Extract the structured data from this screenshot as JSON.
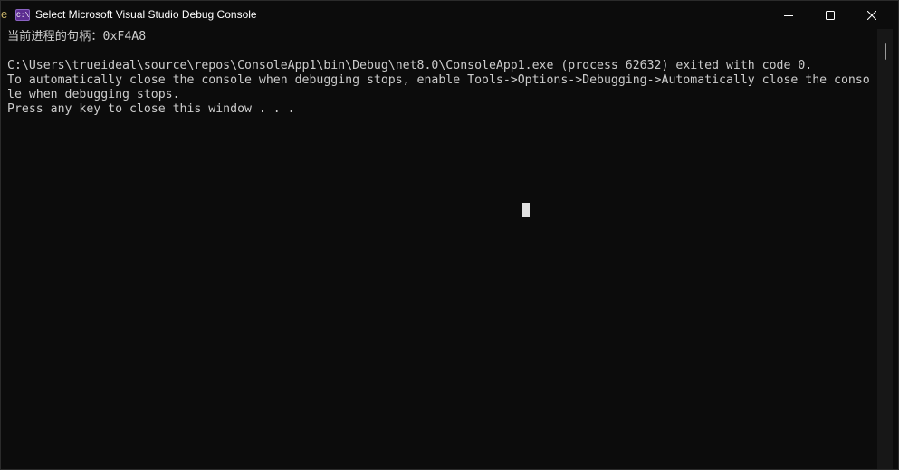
{
  "window": {
    "title": "Select Microsoft Visual Studio Debug Console",
    "app_icon": "vs-debug-console-icon",
    "app_icon_glyph": "C:\\",
    "edge_sliver_text": "e",
    "controls": {
      "minimize_icon": "minimize-icon",
      "maximize_icon": "maximize-icon",
      "close_icon": "close-icon"
    }
  },
  "console": {
    "lines": [
      "当前进程的句柄：0xF4A8",
      "",
      "C:\\Users\\trueideal\\source\\repos\\ConsoleApp1\\bin\\Debug\\net8.0\\ConsoleApp1.exe (process 62632) exited with code 0.",
      "To automatically close the console when debugging stops, enable Tools->Options->Debugging->Automatically close the conso",
      "le when debugging stops.",
      "Press any key to close this window . . ."
    ]
  },
  "colors": {
    "background": "#0c0c0c",
    "text": "#cccccc",
    "title_text": "#ffffff",
    "icon_purple": "#5c2d91",
    "scrollbar_track": "#171717",
    "scrollbar_thumb": "#9a9a9a",
    "cursor": "#e0e0e0"
  }
}
